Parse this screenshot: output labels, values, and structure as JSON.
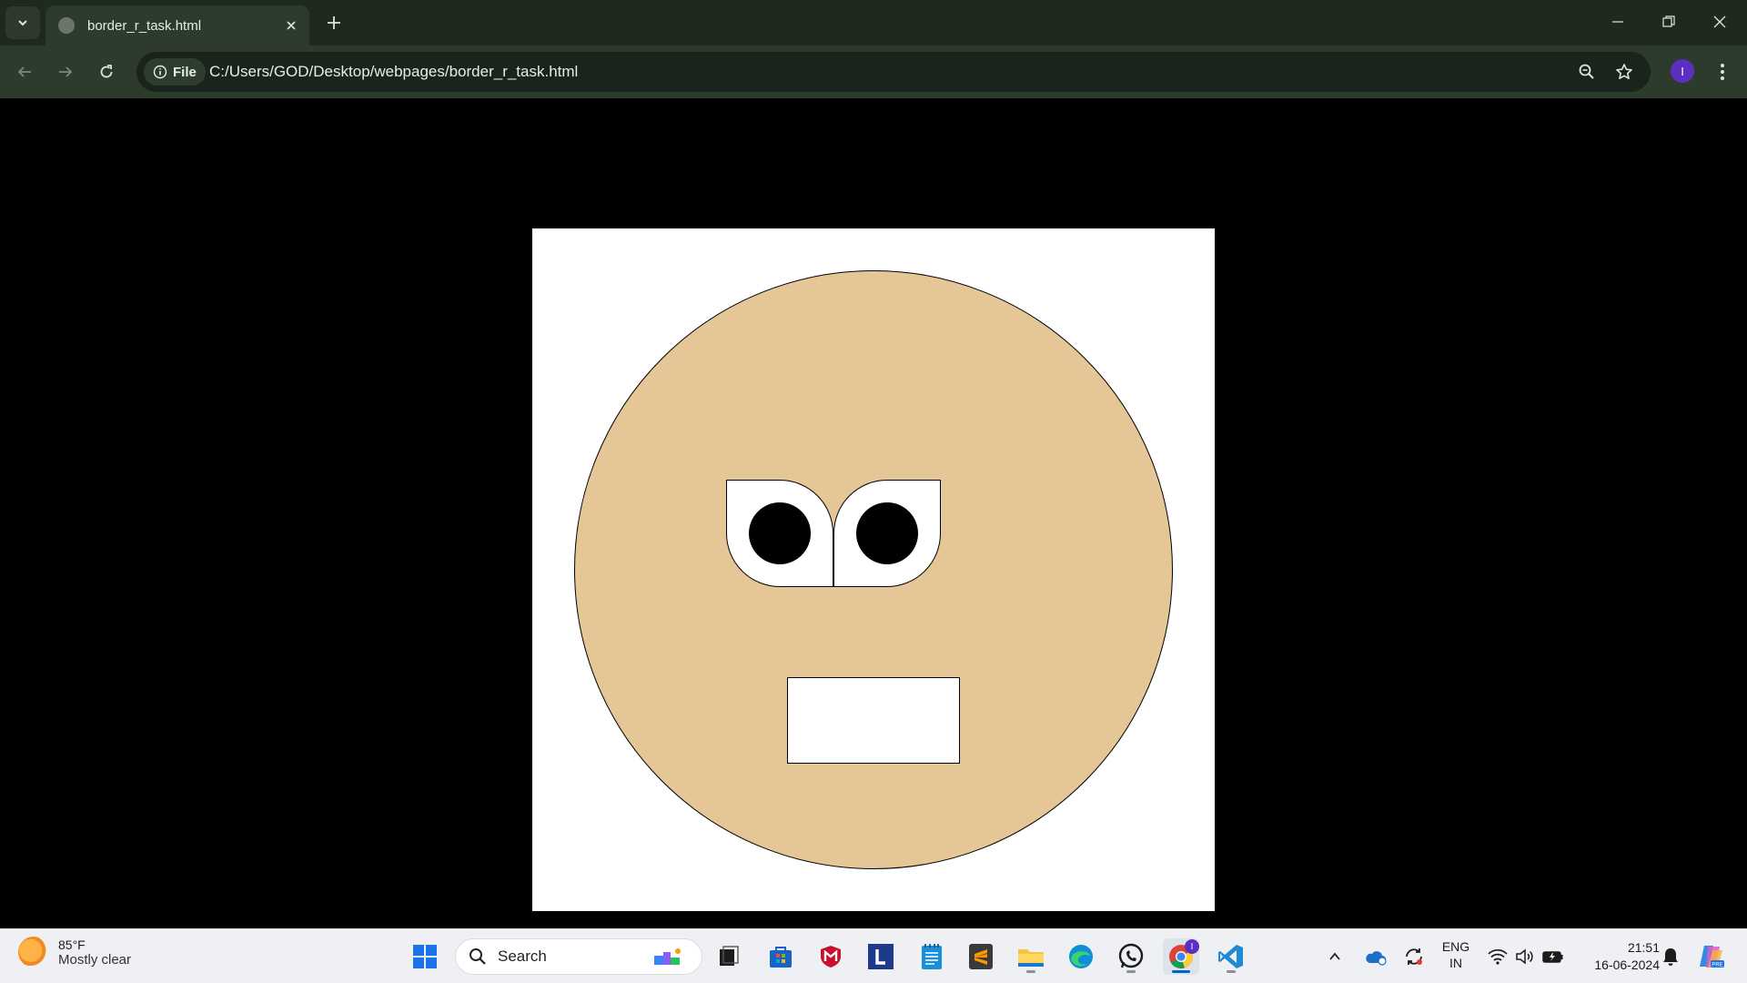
{
  "browser": {
    "tab_title": "border_r_task.html",
    "site_chip_label": "File",
    "url": "C:/Users/GOD/Desktop/webpages/border_r_task.html",
    "profile_initial": "I"
  },
  "page": {
    "canvas_color": "#ffffff",
    "face_color": "#e5c696",
    "background_color": "#000000"
  },
  "taskbar": {
    "weather_temp": "85°F",
    "weather_desc": "Mostly clear",
    "search_label": "Search",
    "lang_line1": "ENG",
    "lang_line2": "IN",
    "time": "21:51",
    "date": "16-06-2024",
    "chrome_badge": "I"
  }
}
